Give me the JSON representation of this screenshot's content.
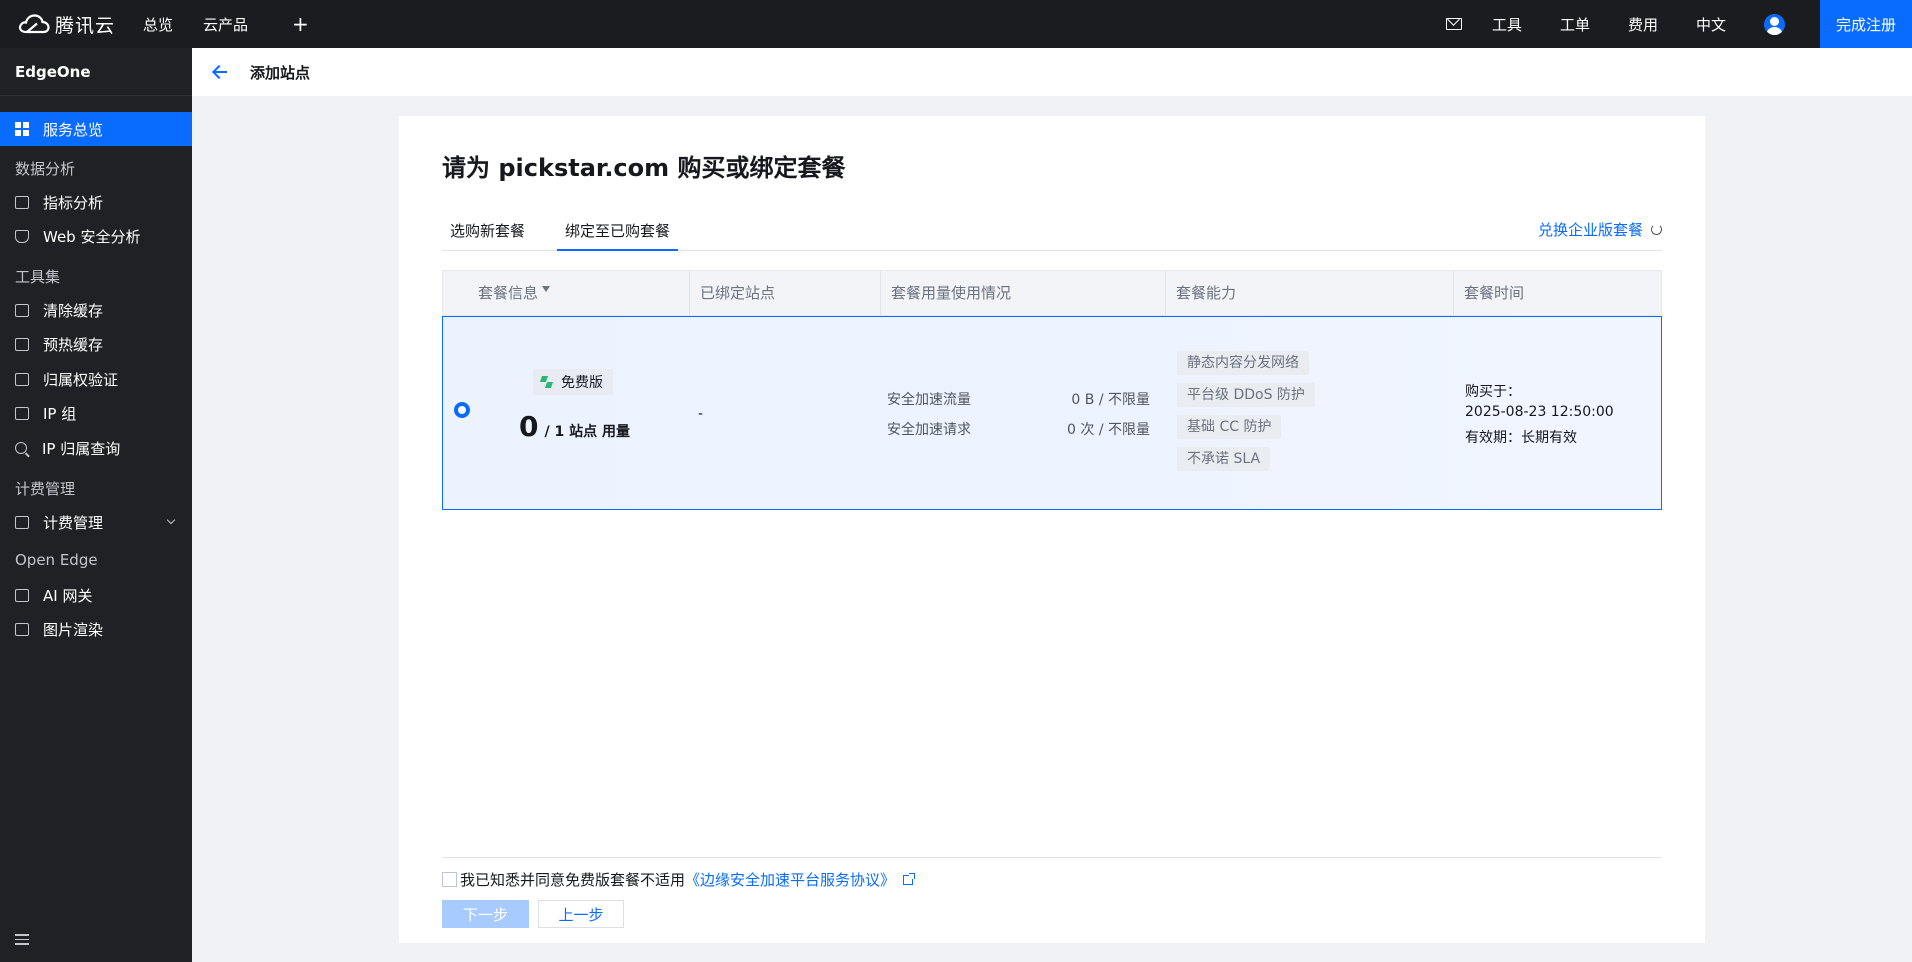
{
  "topbar": {
    "logo_text": "腾讯云",
    "nav": [
      "总览",
      "云产品"
    ],
    "plus": "+",
    "right_nav": [
      "工具",
      "工单",
      "费用",
      "中文"
    ],
    "register_label": "完成注册"
  },
  "sidebar": {
    "product": "EdgeOne",
    "active_item": "服务总览",
    "groups": {
      "data_analysis": "数据分析",
      "toolset": "工具集",
      "billing": "计费管理",
      "open_edge": "Open Edge"
    },
    "items": {
      "metrics": "指标分析",
      "web_security": "Web 安全分析",
      "purge_cache": "清除缓存",
      "prefetch_cache": "预热缓存",
      "ownership": "归属权验证",
      "ip_group": "IP 组",
      "ip_lookup": "IP 归属查询",
      "billing_mgmt": "计费管理",
      "ai_gateway": "AI 网关",
      "image_render": "图片渲染"
    }
  },
  "subheader": {
    "title": "添加站点"
  },
  "main": {
    "heading": "请为 pickstar.com 购买或绑定套餐",
    "tabs": [
      "选购新套餐",
      "绑定至已购套餐"
    ],
    "active_tab": "绑定至已购套餐",
    "exchange_link": "兑换企业版套餐",
    "table": {
      "headers": [
        "套餐信息",
        "已绑定站点",
        "套餐用量使用情况",
        "套餐能力",
        "套餐时间"
      ],
      "row": {
        "selected": true,
        "plan_name": "免费版",
        "usage_count": "0",
        "usage_suffix": "/ 1 站点 用量",
        "bound_sites": "-",
        "metrics": [
          {
            "label": "安全加速流量",
            "value": "0 B / 不限量"
          },
          {
            "label": "安全加速请求",
            "value": "0 次 / 不限量"
          }
        ],
        "capabilities": [
          "静态内容分发网络",
          "平台级 DDoS 防护",
          "基础 CC 防护",
          "不承诺 SLA"
        ],
        "purchase_label": "购买于：",
        "purchase_time": "2025-08-23 12:50:00",
        "validity": "有效期：长期有效"
      }
    },
    "agreement": {
      "text": "我已知悉并同意免费版套餐不适用",
      "link": "《边缘安全加速平台服务协议》",
      "checked": false
    },
    "buttons": {
      "next": "下一步",
      "prev": "上一步"
    }
  },
  "colors": {
    "accent": "#0a6cff",
    "topbar_bg": "#1b1c1f",
    "sidebar_bg": "#202124",
    "selected_row_bg": "#ecf3ff",
    "free_badge_icon": "#2bb673"
  }
}
